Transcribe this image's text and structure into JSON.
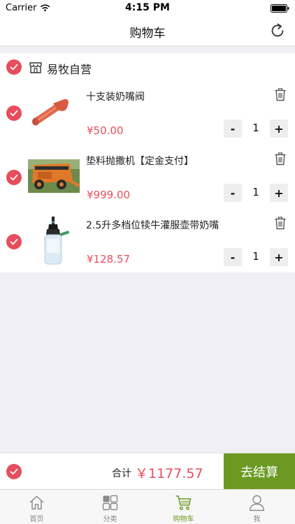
{
  "status_bar": {
    "carrier": "Carrier",
    "time": "4:15 PM"
  },
  "nav": {
    "title": "购物车"
  },
  "store": {
    "name": "易牧自营"
  },
  "items": [
    {
      "title": "十支装奶嘴阀",
      "price": "¥50.00",
      "quantity": "1"
    },
    {
      "title": "垫料抛撒机【定金支付】",
      "price": "¥999.00",
      "quantity": "1"
    },
    {
      "title": "2.5升多档位犊牛灌服壶带奶嘴",
      "price": "¥128.57",
      "quantity": "1"
    }
  ],
  "stepper": {
    "minus": "-",
    "plus": "+"
  },
  "checkout": {
    "total_label": "合计",
    "total_value": "￥1177.57",
    "button_label": "去结算"
  },
  "tabs": [
    {
      "label": "首页",
      "icon": "home-icon"
    },
    {
      "label": "分类",
      "icon": "category-icon"
    },
    {
      "label": "购物车",
      "icon": "cart-icon",
      "active": true
    },
    {
      "label": "我",
      "icon": "profile-icon"
    }
  ],
  "colors": {
    "accent": "#e64e5e",
    "brand_green": "#6b9a22",
    "background": "#efeff4"
  }
}
